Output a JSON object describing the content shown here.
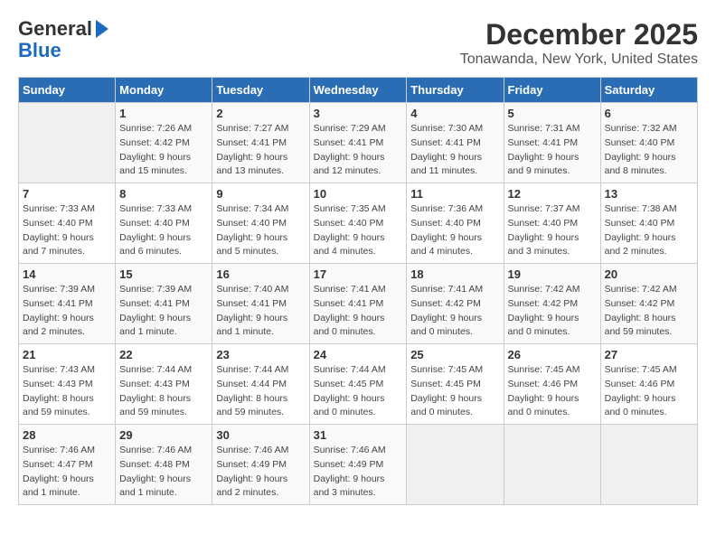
{
  "logo": {
    "line1": "General",
    "line2": "Blue"
  },
  "title": "December 2025",
  "subtitle": "Tonawanda, New York, United States",
  "days_of_week": [
    "Sunday",
    "Monday",
    "Tuesday",
    "Wednesday",
    "Thursday",
    "Friday",
    "Saturday"
  ],
  "weeks": [
    [
      {
        "day": "",
        "empty": true
      },
      {
        "day": "1",
        "sunrise": "7:26 AM",
        "sunset": "4:42 PM",
        "daylight": "9 hours and 15 minutes."
      },
      {
        "day": "2",
        "sunrise": "7:27 AM",
        "sunset": "4:41 PM",
        "daylight": "9 hours and 13 minutes."
      },
      {
        "day": "3",
        "sunrise": "7:29 AM",
        "sunset": "4:41 PM",
        "daylight": "9 hours and 12 minutes."
      },
      {
        "day": "4",
        "sunrise": "7:30 AM",
        "sunset": "4:41 PM",
        "daylight": "9 hours and 11 minutes."
      },
      {
        "day": "5",
        "sunrise": "7:31 AM",
        "sunset": "4:41 PM",
        "daylight": "9 hours and 9 minutes."
      },
      {
        "day": "6",
        "sunrise": "7:32 AM",
        "sunset": "4:40 PM",
        "daylight": "9 hours and 8 minutes."
      }
    ],
    [
      {
        "day": "7",
        "sunrise": "7:33 AM",
        "sunset": "4:40 PM",
        "daylight": "9 hours and 7 minutes."
      },
      {
        "day": "8",
        "sunrise": "7:33 AM",
        "sunset": "4:40 PM",
        "daylight": "9 hours and 6 minutes."
      },
      {
        "day": "9",
        "sunrise": "7:34 AM",
        "sunset": "4:40 PM",
        "daylight": "9 hours and 5 minutes."
      },
      {
        "day": "10",
        "sunrise": "7:35 AM",
        "sunset": "4:40 PM",
        "daylight": "9 hours and 4 minutes."
      },
      {
        "day": "11",
        "sunrise": "7:36 AM",
        "sunset": "4:40 PM",
        "daylight": "9 hours and 4 minutes."
      },
      {
        "day": "12",
        "sunrise": "7:37 AM",
        "sunset": "4:40 PM",
        "daylight": "9 hours and 3 minutes."
      },
      {
        "day": "13",
        "sunrise": "7:38 AM",
        "sunset": "4:40 PM",
        "daylight": "9 hours and 2 minutes."
      }
    ],
    [
      {
        "day": "14",
        "sunrise": "7:39 AM",
        "sunset": "4:41 PM",
        "daylight": "9 hours and 2 minutes."
      },
      {
        "day": "15",
        "sunrise": "7:39 AM",
        "sunset": "4:41 PM",
        "daylight": "9 hours and 1 minute."
      },
      {
        "day": "16",
        "sunrise": "7:40 AM",
        "sunset": "4:41 PM",
        "daylight": "9 hours and 1 minute."
      },
      {
        "day": "17",
        "sunrise": "7:41 AM",
        "sunset": "4:41 PM",
        "daylight": "9 hours and 0 minutes."
      },
      {
        "day": "18",
        "sunrise": "7:41 AM",
        "sunset": "4:42 PM",
        "daylight": "9 hours and 0 minutes."
      },
      {
        "day": "19",
        "sunrise": "7:42 AM",
        "sunset": "4:42 PM",
        "daylight": "9 hours and 0 minutes."
      },
      {
        "day": "20",
        "sunrise": "7:42 AM",
        "sunset": "4:42 PM",
        "daylight": "8 hours and 59 minutes."
      }
    ],
    [
      {
        "day": "21",
        "sunrise": "7:43 AM",
        "sunset": "4:43 PM",
        "daylight": "8 hours and 59 minutes."
      },
      {
        "day": "22",
        "sunrise": "7:44 AM",
        "sunset": "4:43 PM",
        "daylight": "8 hours and 59 minutes."
      },
      {
        "day": "23",
        "sunrise": "7:44 AM",
        "sunset": "4:44 PM",
        "daylight": "8 hours and 59 minutes."
      },
      {
        "day": "24",
        "sunrise": "7:44 AM",
        "sunset": "4:45 PM",
        "daylight": "9 hours and 0 minutes."
      },
      {
        "day": "25",
        "sunrise": "7:45 AM",
        "sunset": "4:45 PM",
        "daylight": "9 hours and 0 minutes."
      },
      {
        "day": "26",
        "sunrise": "7:45 AM",
        "sunset": "4:46 PM",
        "daylight": "9 hours and 0 minutes."
      },
      {
        "day": "27",
        "sunrise": "7:45 AM",
        "sunset": "4:46 PM",
        "daylight": "9 hours and 0 minutes."
      }
    ],
    [
      {
        "day": "28",
        "sunrise": "7:46 AM",
        "sunset": "4:47 PM",
        "daylight": "9 hours and 1 minute."
      },
      {
        "day": "29",
        "sunrise": "7:46 AM",
        "sunset": "4:48 PM",
        "daylight": "9 hours and 1 minute."
      },
      {
        "day": "30",
        "sunrise": "7:46 AM",
        "sunset": "4:49 PM",
        "daylight": "9 hours and 2 minutes."
      },
      {
        "day": "31",
        "sunrise": "7:46 AM",
        "sunset": "4:49 PM",
        "daylight": "9 hours and 3 minutes."
      },
      {
        "day": "",
        "empty": true
      },
      {
        "day": "",
        "empty": true
      },
      {
        "day": "",
        "empty": true
      }
    ]
  ]
}
